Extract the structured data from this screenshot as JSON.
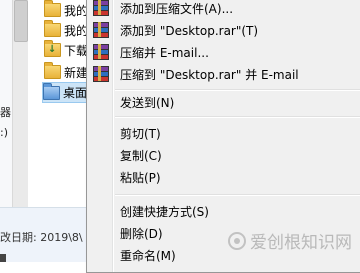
{
  "explorer": {
    "left_labels": [
      "器",
      ":)"
    ],
    "tree": [
      {
        "label": "我的",
        "icon": "folder-icon"
      },
      {
        "label": "我的",
        "icon": "folder-icon"
      },
      {
        "label": "下载",
        "icon": "download-folder-icon"
      },
      {
        "label": "新建",
        "icon": "folder-icon"
      },
      {
        "label": "桌面",
        "icon": "desktop-folder-icon"
      }
    ],
    "status_text": "改日期: 2019\\8\\"
  },
  "context_menu": {
    "items": [
      {
        "label": "添加到压缩文件(A)...",
        "icon": "winrar-icon"
      },
      {
        "label": "添加到 \"Desktop.rar\"(T)",
        "icon": "winrar-icon"
      },
      {
        "label": "压缩并 E-mail...",
        "icon": "winrar-icon"
      },
      {
        "label": "压缩到 \"Desktop.rar\" 并 E-mail",
        "icon": "winrar-icon"
      },
      {
        "label": "发送到(N)"
      },
      {
        "label": "剪切(T)"
      },
      {
        "label": "复制(C)"
      },
      {
        "label": "粘贴(P)"
      },
      {
        "label": "创建快捷方式(S)"
      },
      {
        "label": "删除(D)"
      },
      {
        "label": "重命名(M)"
      }
    ]
  },
  "watermark": {
    "text": "爱创根知识网"
  }
}
